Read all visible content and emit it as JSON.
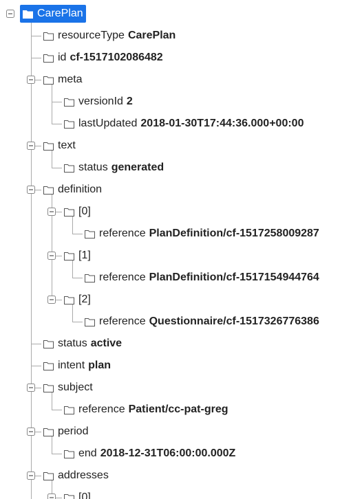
{
  "tree": [
    {
      "d": 0,
      "key": "CarePlan",
      "val": "",
      "exp": true,
      "root": true
    },
    {
      "d": 1,
      "key": "resourceType",
      "val": "CarePlan",
      "exp": false
    },
    {
      "d": 1,
      "key": "id",
      "val": "cf-1517102086482",
      "exp": false
    },
    {
      "d": 1,
      "key": "meta",
      "val": "",
      "exp": true
    },
    {
      "d": 2,
      "key": "versionId",
      "val": "2",
      "exp": false
    },
    {
      "d": 2,
      "key": "lastUpdated",
      "val": "2018-01-30T17:44:36.000+00:00",
      "exp": false
    },
    {
      "d": 1,
      "key": "text",
      "val": "",
      "exp": true
    },
    {
      "d": 2,
      "key": "status",
      "val": "generated",
      "exp": false
    },
    {
      "d": 1,
      "key": "definition",
      "val": "",
      "exp": true
    },
    {
      "d": 2,
      "key": "[0]",
      "val": "",
      "exp": true
    },
    {
      "d": 3,
      "key": "reference",
      "val": "PlanDefinition/cf-1517258009287",
      "exp": false
    },
    {
      "d": 2,
      "key": "[1]",
      "val": "",
      "exp": true
    },
    {
      "d": 3,
      "key": "reference",
      "val": "PlanDefinition/cf-1517154944764",
      "exp": false
    },
    {
      "d": 2,
      "key": "[2]",
      "val": "",
      "exp": true
    },
    {
      "d": 3,
      "key": "reference",
      "val": "Questionnaire/cf-1517326776386",
      "exp": false
    },
    {
      "d": 1,
      "key": "status",
      "val": "active",
      "exp": false
    },
    {
      "d": 1,
      "key": "intent",
      "val": "plan",
      "exp": false
    },
    {
      "d": 1,
      "key": "subject",
      "val": "",
      "exp": true
    },
    {
      "d": 2,
      "key": "reference",
      "val": "Patient/cc-pat-greg",
      "exp": false
    },
    {
      "d": 1,
      "key": "period",
      "val": "",
      "exp": true
    },
    {
      "d": 2,
      "key": "end",
      "val": "2018-12-31T06:00:00.000Z",
      "exp": false
    },
    {
      "d": 1,
      "key": "addresses",
      "val": "",
      "exp": true
    },
    {
      "d": 2,
      "key": "[0]",
      "val": "",
      "exp": true
    }
  ],
  "colors": {
    "selected_bg": "#1a73e8",
    "line": "#aaaaaa",
    "icon": "#555555"
  },
  "icons": {
    "folder": "folder-icon",
    "toggle_expanded": "minus-box-icon"
  }
}
